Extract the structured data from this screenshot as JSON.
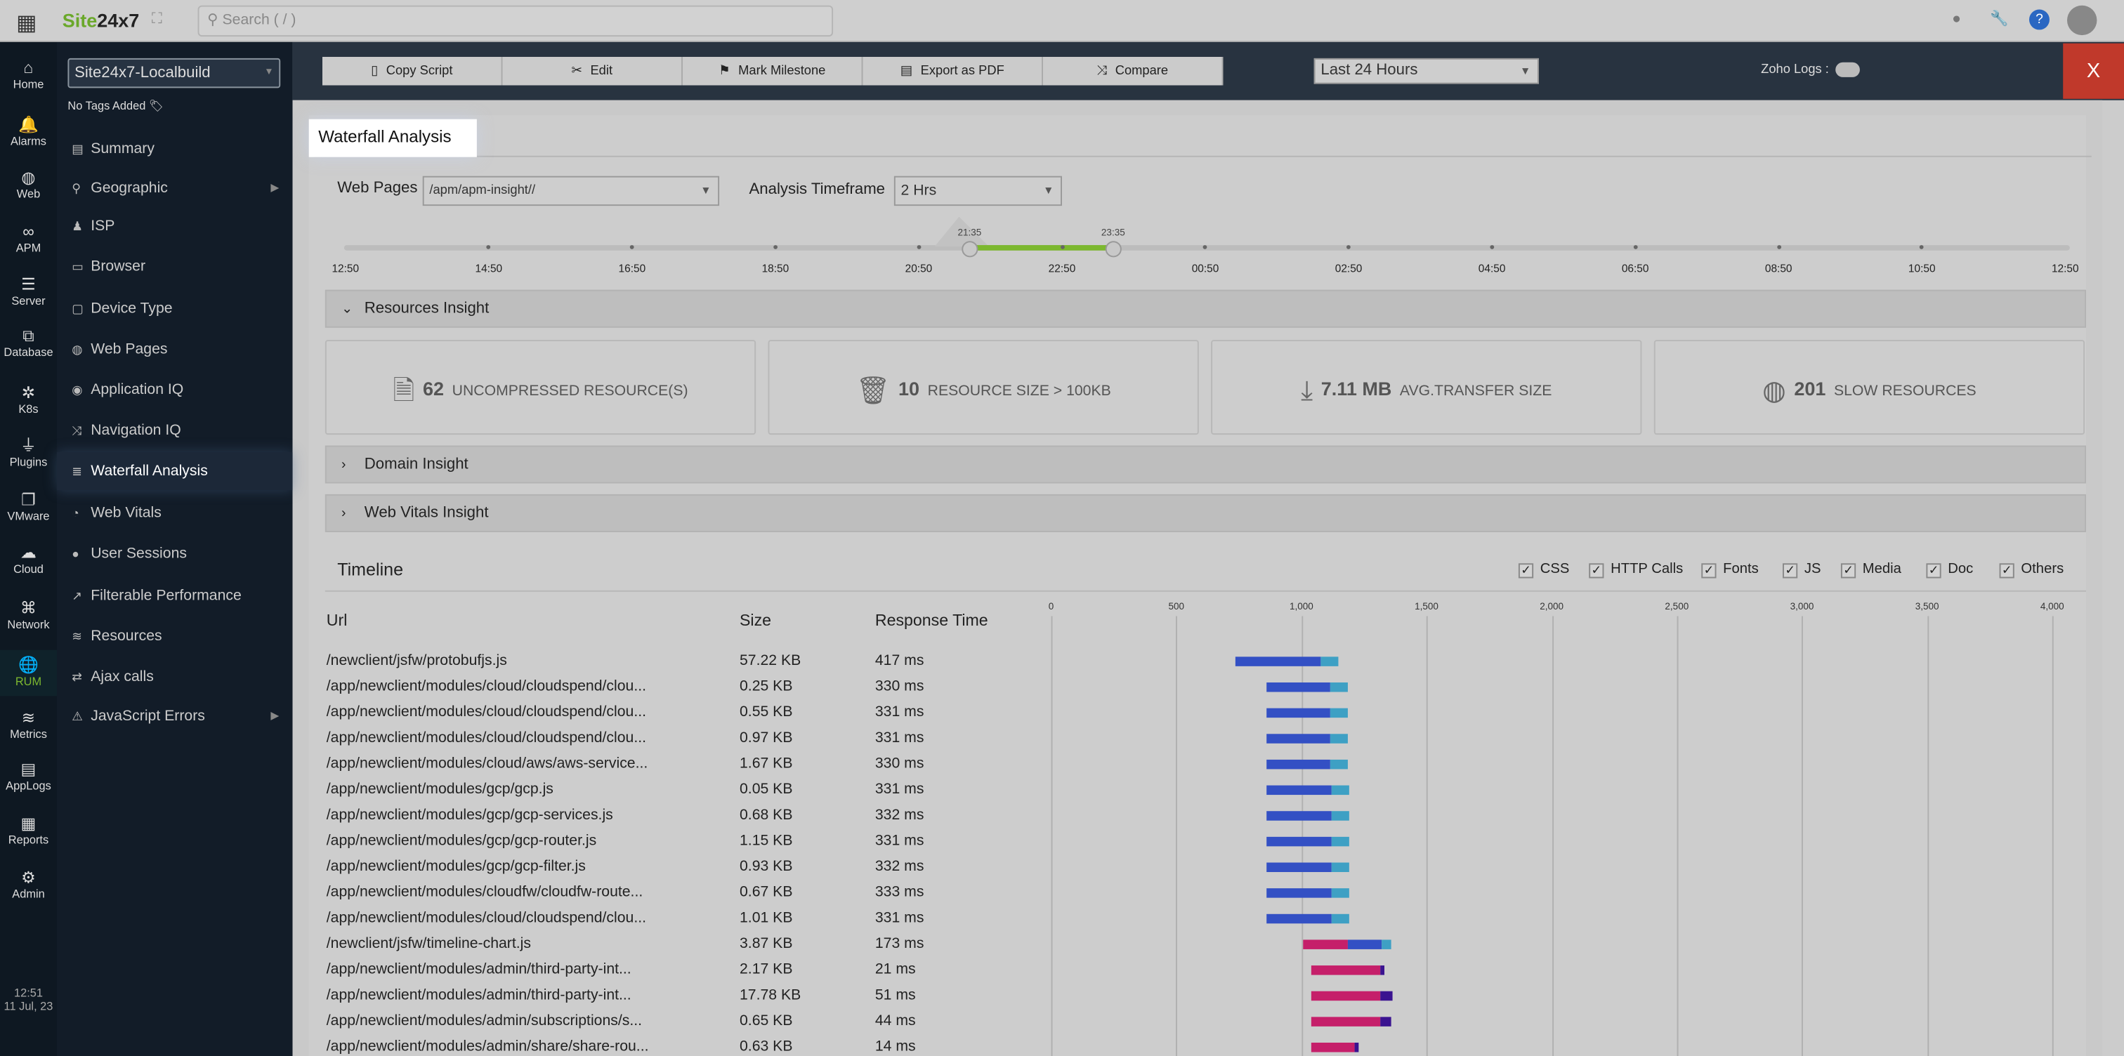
{
  "topbar": {
    "brand_a": "Site",
    "brand_b": "24x7",
    "search_placeholder": "Search ( / )"
  },
  "rail": [
    {
      "label": "Home",
      "icon": "⌂"
    },
    {
      "label": "Alarms",
      "icon": "🔔"
    },
    {
      "label": "Web",
      "icon": "◍"
    },
    {
      "label": "APM",
      "icon": "∞"
    },
    {
      "label": "Server",
      "icon": "☰"
    },
    {
      "label": "Database",
      "icon": "⧉"
    },
    {
      "label": "K8s",
      "icon": "✲"
    },
    {
      "label": "Plugins",
      "icon": "⏚"
    },
    {
      "label": "VMware",
      "icon": "❐"
    },
    {
      "label": "Cloud",
      "icon": "☁"
    },
    {
      "label": "Network",
      "icon": "⌘"
    },
    {
      "label": "RUM",
      "icon": "🌐"
    },
    {
      "label": "Metrics",
      "icon": "≋"
    },
    {
      "label": "AppLogs",
      "icon": "▤"
    },
    {
      "label": "Reports",
      "icon": "▦"
    },
    {
      "label": "Admin",
      "icon": "⚙"
    }
  ],
  "clock": {
    "time": "12:51",
    "date": "11 Jul, 23"
  },
  "sidebar": {
    "monitor": "Site24x7-Localbuild",
    "tags": "No Tags Added",
    "items": [
      {
        "label": "Summary",
        "icon": "▤"
      },
      {
        "label": "Geographic",
        "icon": "⚲",
        "sub": true
      },
      {
        "label": "ISP",
        "icon": "♟"
      },
      {
        "label": "Browser",
        "icon": "▭"
      },
      {
        "label": "Device Type",
        "icon": "▢"
      },
      {
        "label": "Web Pages",
        "icon": "◍"
      },
      {
        "label": "Application IQ",
        "icon": "◉"
      },
      {
        "label": "Navigation IQ",
        "icon": "⤨"
      },
      {
        "label": "Waterfall Analysis",
        "icon": "≣",
        "active": true
      },
      {
        "label": "Web Vitals",
        "icon": "◔"
      },
      {
        "label": "User Sessions",
        "icon": "●"
      },
      {
        "label": "Filterable Performance",
        "icon": "↗"
      },
      {
        "label": "Resources",
        "icon": "≋"
      },
      {
        "label": "Ajax calls",
        "icon": "⇄"
      },
      {
        "label": "JavaScript Errors",
        "icon": "⚠",
        "sub": true
      }
    ]
  },
  "toolbar": {
    "buttons": [
      {
        "label": "Copy Script",
        "icon": "▯"
      },
      {
        "label": "Edit",
        "icon": "✂"
      },
      {
        "label": "Mark Milestone",
        "icon": "⚑"
      },
      {
        "label": "Export as PDF",
        "icon": "▤"
      },
      {
        "label": "Compare",
        "icon": "⤨"
      }
    ],
    "period": "Last 24 Hours",
    "zoho_logs": "Zoho Logs :",
    "close": "X"
  },
  "page": {
    "title": "Waterfall Analysis",
    "web_pages_label": "Web Pages",
    "web_page": "/apm/apm-insight//",
    "timeframe_label": "Analysis Timeframe",
    "timeframe": "2 Hrs"
  },
  "timeline_slider": {
    "labels": [
      "12:50",
      "14:50",
      "16:50",
      "18:50",
      "20:50",
      "22:50",
      "00:50",
      "02:50",
      "04:50",
      "06:50",
      "08:50",
      "10:50",
      "12:50"
    ],
    "range_start": "21:35",
    "range_end": "23:35",
    "accent": "#7cb82f"
  },
  "sections": {
    "resources": "Resources Insight",
    "domain": "Domain Insight",
    "vitals": "Web Vitals Insight"
  },
  "cards": [
    {
      "value": "62",
      "label": "UNCOMPRESSED RESOURCE(S)",
      "icon": "file-icon"
    },
    {
      "value": "10",
      "label": "RESOURCE SIZE > 100KB",
      "icon": "bin-icon"
    },
    {
      "value": "7.11 MB",
      "label": "AVG.TRANSFER SIZE",
      "icon": "download-icon"
    },
    {
      "value": "201",
      "label": "SLOW RESOURCES",
      "icon": "globe-icon"
    }
  ],
  "timeline": {
    "title": "Timeline",
    "filters": [
      {
        "label": "CSS",
        "checked": true
      },
      {
        "label": "HTTP Calls",
        "checked": true
      },
      {
        "label": "Fonts",
        "checked": true
      },
      {
        "label": "JS",
        "checked": true
      },
      {
        "label": "Media",
        "checked": true
      },
      {
        "label": "Doc",
        "checked": true
      },
      {
        "label": "Others",
        "checked": true
      }
    ],
    "columns": {
      "url": "Url",
      "size": "Size",
      "response": "Response Time"
    }
  },
  "chart_data": {
    "type": "bar",
    "xlim": [
      0,
      4000
    ],
    "ticks": [
      "0",
      "500",
      "1,000",
      "1,500",
      "2,000",
      "2,500",
      "3,000",
      "3,500",
      "4,000"
    ],
    "segment_colors": {
      "pink": "#c51f6a",
      "blue": "#3350c4",
      "cyan": "#3ea0c4",
      "purple": "#3a1390"
    },
    "rows": [
      {
        "url": "/newclient/jsfw/protobufjs.js",
        "size": "57.22 KB",
        "time": "417 ms",
        "segments": [
          [
            735,
            1075,
            "blue"
          ],
          [
            1075,
            1149,
            "cyan"
          ]
        ]
      },
      {
        "url": "/app/newclient/modules/cloud/cloudspend/clou...",
        "size": "0.25 KB",
        "time": "330 ms",
        "segments": [
          [
            859,
            1116,
            "blue"
          ],
          [
            1116,
            1188,
            "cyan"
          ]
        ]
      },
      {
        "url": "/app/newclient/modules/cloud/cloudspend/clou...",
        "size": "0.55 KB",
        "time": "331 ms",
        "segments": [
          [
            859,
            1116,
            "blue"
          ],
          [
            1116,
            1188,
            "cyan"
          ]
        ]
      },
      {
        "url": "/app/newclient/modules/cloud/cloudspend/clou...",
        "size": "0.97 KB",
        "time": "331 ms",
        "segments": [
          [
            859,
            1116,
            "blue"
          ],
          [
            1116,
            1188,
            "cyan"
          ]
        ]
      },
      {
        "url": "/app/newclient/modules/cloud/aws/aws-service...",
        "size": "1.67 KB",
        "time": "330 ms",
        "segments": [
          [
            859,
            1116,
            "blue"
          ],
          [
            1116,
            1188,
            "cyan"
          ]
        ]
      },
      {
        "url": "/app/newclient/modules/gcp/gcp.js",
        "size": "0.05 KB",
        "time": "331 ms",
        "segments": [
          [
            859,
            1118,
            "blue"
          ],
          [
            1118,
            1190,
            "cyan"
          ]
        ]
      },
      {
        "url": "/app/newclient/modules/gcp/gcp-services.js",
        "size": "0.68 KB",
        "time": "332 ms",
        "segments": [
          [
            859,
            1118,
            "blue"
          ],
          [
            1118,
            1190,
            "cyan"
          ]
        ]
      },
      {
        "url": "/app/newclient/modules/gcp/gcp-router.js",
        "size": "1.15 KB",
        "time": "331 ms",
        "segments": [
          [
            859,
            1118,
            "blue"
          ],
          [
            1118,
            1190,
            "cyan"
          ]
        ]
      },
      {
        "url": "/app/newclient/modules/gcp/gcp-filter.js",
        "size": "0.93 KB",
        "time": "332 ms",
        "segments": [
          [
            859,
            1118,
            "blue"
          ],
          [
            1118,
            1190,
            "cyan"
          ]
        ]
      },
      {
        "url": "/app/newclient/modules/cloudfw/cloudfw-route...",
        "size": "0.67 KB",
        "time": "333 ms",
        "segments": [
          [
            859,
            1120,
            "blue"
          ],
          [
            1120,
            1192,
            "cyan"
          ]
        ]
      },
      {
        "url": "/app/newclient/modules/cloud/cloudspend/clou...",
        "size": "1.01 KB",
        "time": "331 ms",
        "segments": [
          [
            859,
            1118,
            "blue"
          ],
          [
            1118,
            1190,
            "cyan"
          ]
        ]
      },
      {
        "url": "/newclient/jsfw/timeline-chart.js",
        "size": "3.87 KB",
        "time": "173 ms",
        "segments": [
          [
            1008,
            1188,
            "pink"
          ],
          [
            1188,
            1320,
            "blue"
          ],
          [
            1320,
            1359,
            "cyan"
          ]
        ]
      },
      {
        "url": "/app/newclient/modules/admin/third-party-int...",
        "size": "2.17 KB",
        "time": "21 ms",
        "segments": [
          [
            1041,
            1315,
            "pink"
          ],
          [
            1315,
            1331,
            "purple"
          ]
        ]
      },
      {
        "url": "/app/newclient/modules/admin/third-party-int...",
        "size": "17.78 KB",
        "time": "51 ms",
        "segments": [
          [
            1041,
            1315,
            "pink"
          ],
          [
            1315,
            1362,
            "purple"
          ]
        ]
      },
      {
        "url": "/app/newclient/modules/admin/subscriptions/s...",
        "size": "0.65 KB",
        "time": "44 ms",
        "segments": [
          [
            1041,
            1315,
            "pink"
          ],
          [
            1315,
            1356,
            "purple"
          ]
        ]
      },
      {
        "url": "/app/newclient/modules/admin/share/share-rou...",
        "size": "0.63 KB",
        "time": "14 ms",
        "segments": [
          [
            1041,
            1213,
            "pink"
          ],
          [
            1213,
            1227,
            "purple"
          ]
        ]
      }
    ]
  }
}
